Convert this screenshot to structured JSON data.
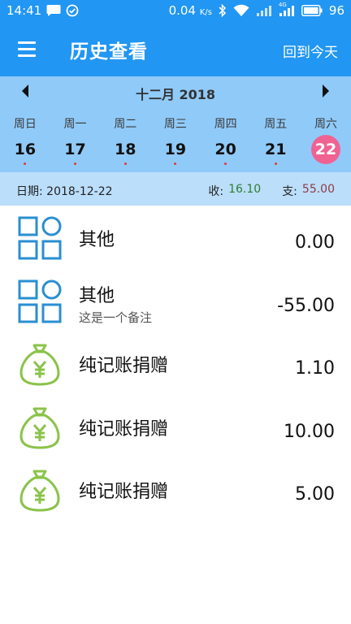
{
  "status_bar": {
    "time": "14:41",
    "speed_value": "0.04",
    "speed_unit": "K/s",
    "network": "4G",
    "battery": "96"
  },
  "app_bar": {
    "title": "历史查看",
    "back_today_label": "回到今天"
  },
  "calendar": {
    "month_label": "十二月 2018",
    "weekdays": [
      "周日",
      "周一",
      "周二",
      "周三",
      "周四",
      "周五",
      "周六"
    ],
    "days": [
      "16",
      "17",
      "18",
      "19",
      "20",
      "21",
      "22"
    ],
    "selected_day": "22"
  },
  "summary": {
    "date_label": "日期:",
    "date_value": "2018-12-22",
    "income_label": "收:",
    "income_value": "16.10",
    "expense_label": "支:",
    "expense_value": "55.00"
  },
  "records": [
    {
      "icon": "category-grid-icon",
      "name": "其他",
      "note": "",
      "amount": "0.00"
    },
    {
      "icon": "category-grid-icon",
      "name": "其他",
      "note": "这是一个备注",
      "amount": "-55.00"
    },
    {
      "icon": "money-bag-icon",
      "name": "纯记账捐赠",
      "note": "",
      "amount": "1.10"
    },
    {
      "icon": "money-bag-icon",
      "name": "纯记账捐赠",
      "note": "",
      "amount": "10.00"
    },
    {
      "icon": "money-bag-icon",
      "name": "纯记账捐赠",
      "note": "",
      "amount": "5.00"
    }
  ],
  "colors": {
    "primary": "#2196F3",
    "calendar_bg": "#90CAF9",
    "summary_bg": "#BBDEFB",
    "selected_day": "#F06292",
    "income": "#2E7D32",
    "expense": "#8E3B46",
    "grid_icon": "#2A8FD0",
    "bag_icon": "#8BC34A"
  }
}
